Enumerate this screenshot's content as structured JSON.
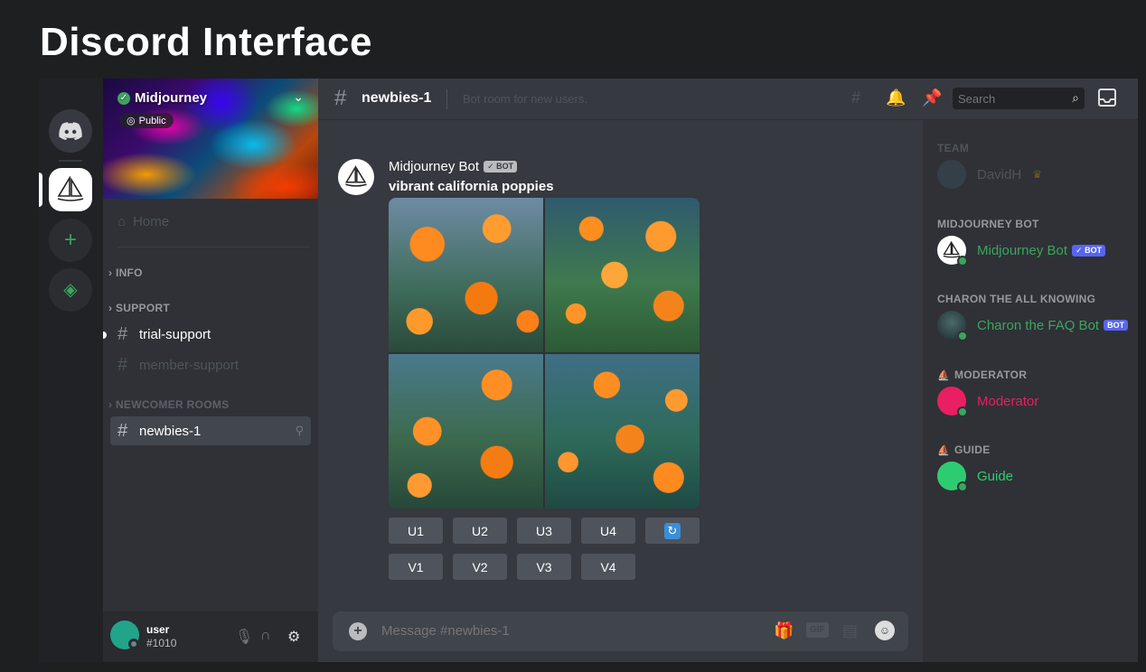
{
  "page_title": "Discord Interface",
  "server": {
    "name": "Midjourney",
    "badge": "Public"
  },
  "sidebar": {
    "home_label": "Home",
    "categories": {
      "info": "INFO",
      "support": "SUPPORT",
      "newcomer": "NEWCOMER ROOMS"
    },
    "channels": {
      "trial": "trial-support",
      "member": "member-support",
      "newbies": "newbies-1"
    }
  },
  "user": {
    "name": "user",
    "tag": "#1010"
  },
  "header": {
    "channel": "newbies-1",
    "topic": "Bot room for new users.",
    "search_placeholder": "Search"
  },
  "message": {
    "author": "Midjourney Bot",
    "bot_tag": "✓ BOT",
    "text": "vibrant california poppies"
  },
  "actions": {
    "upscale": [
      "U1",
      "U2",
      "U3",
      "U4"
    ],
    "variation": [
      "V1",
      "V2",
      "V3",
      "V4"
    ]
  },
  "composer": {
    "placeholder": "Message #newbies-1",
    "gif_label": "GIF"
  },
  "members": {
    "team": {
      "label": "TEAM",
      "member": "DavidH"
    },
    "mj_bot": {
      "label": "MIDJOURNEY BOT",
      "member": "Midjourney Bot",
      "tag": "✓ BOT"
    },
    "charon": {
      "label": "CHARON THE ALL KNOWING",
      "member": "Charon the FAQ Bot",
      "tag": "BOT"
    },
    "moderator": {
      "label": "MODERATOR",
      "member": "Moderator"
    },
    "guide": {
      "label": "GUIDE",
      "member": "Guide"
    }
  },
  "colors": {
    "accent": "#5865f2",
    "online": "#3ba55d",
    "bot_name": "#3ba55d",
    "moderator": "#e91e63",
    "guide": "#2ecc71"
  }
}
